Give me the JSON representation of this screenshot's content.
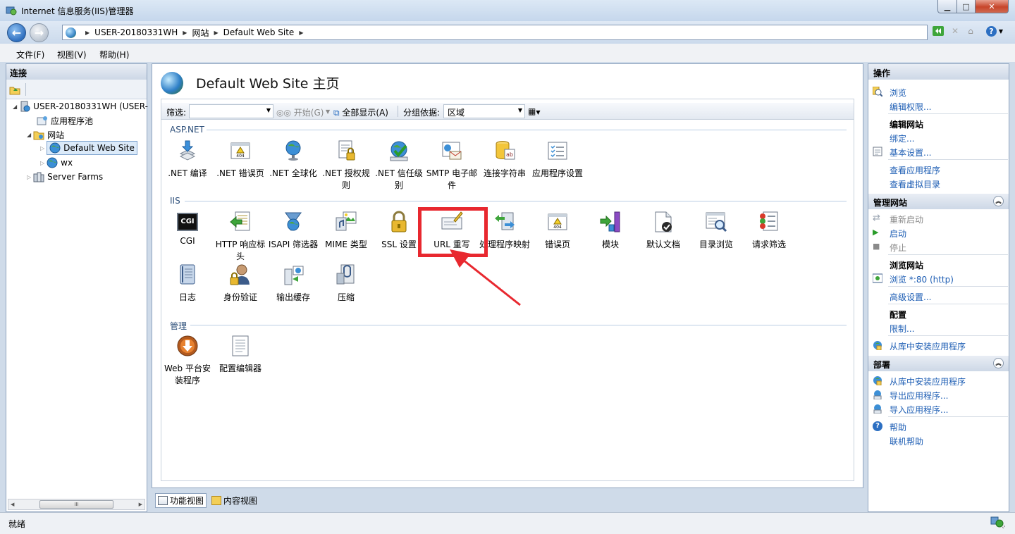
{
  "window": {
    "title": "Internet 信息服务(IIS)管理器"
  },
  "nav": {
    "breadcrumbs": [
      "USER-20180331WH",
      "网站",
      "Default Web Site"
    ]
  },
  "menu": [
    "文件(F)",
    "视图(V)",
    "帮助(H)"
  ],
  "connections": {
    "title": "连接",
    "tree": {
      "server": "USER-20180331WH (USER-",
      "app_pools": "应用程序池",
      "sites": "网站",
      "site_default": "Default Web Site",
      "site_wx": "wx",
      "server_farms": "Server Farms"
    },
    "scroll_label": "III"
  },
  "main": {
    "title": "Default Web Site 主页",
    "filter": {
      "label": "筛选:",
      "go": "开始(G)",
      "show_all": "全部显示(A)",
      "group_by_label": "分组依据:",
      "group_by_value": "区域"
    },
    "sections": {
      "aspnet": {
        "title": "ASP.NET",
        "items": [
          ".NET 编译",
          ".NET 错误页",
          ".NET 全球化",
          ".NET 授权规则",
          ".NET 信任级别",
          "SMTP 电子邮件",
          "连接字符串",
          "应用程序设置"
        ]
      },
      "iis": {
        "title": "IIS",
        "items": [
          "CGI",
          "HTTP 响应标头",
          "ISAPI 筛选器",
          "MIME 类型",
          "SSL 设置",
          "URL 重写",
          "处理程序映射",
          "错误页",
          "模块",
          "默认文档",
          "目录浏览",
          "请求筛选",
          "日志",
          "身份验证",
          "输出缓存",
          "压缩"
        ]
      },
      "manage": {
        "title": "管理",
        "items": [
          "Web 平台安装程序",
          "配置编辑器"
        ]
      }
    },
    "cgi_badge": "CGI",
    "err_badge": "404"
  },
  "tabs": {
    "features": "功能视图",
    "content": "内容视图"
  },
  "actions": {
    "title": "操作",
    "browse": "浏览",
    "edit_perms": "编辑权限...",
    "edit_site": "编辑网站",
    "bindings": "绑定...",
    "basic_settings": "基本设置...",
    "view_apps": "查看应用程序",
    "view_vdirs": "查看虚拟目录",
    "manage_site": "管理网站",
    "restart": "重新启动",
    "start": "启动",
    "stop": "停止",
    "browse_site": "浏览网站",
    "browse_80": "浏览 *:80 (http)",
    "advanced": "高级设置...",
    "config": "配置",
    "limits": "限制...",
    "install_from_gallery": "从库中安装应用程序",
    "deploy": "部署",
    "deploy_install": "从库中安装应用程序",
    "export_app": "导出应用程序...",
    "import_app": "导入应用程序...",
    "help": "帮助",
    "online_help": "联机帮助"
  },
  "status": {
    "text": "就绪"
  },
  "colors": {
    "annotation": "#e8282f",
    "link": "#1e5eb4"
  }
}
